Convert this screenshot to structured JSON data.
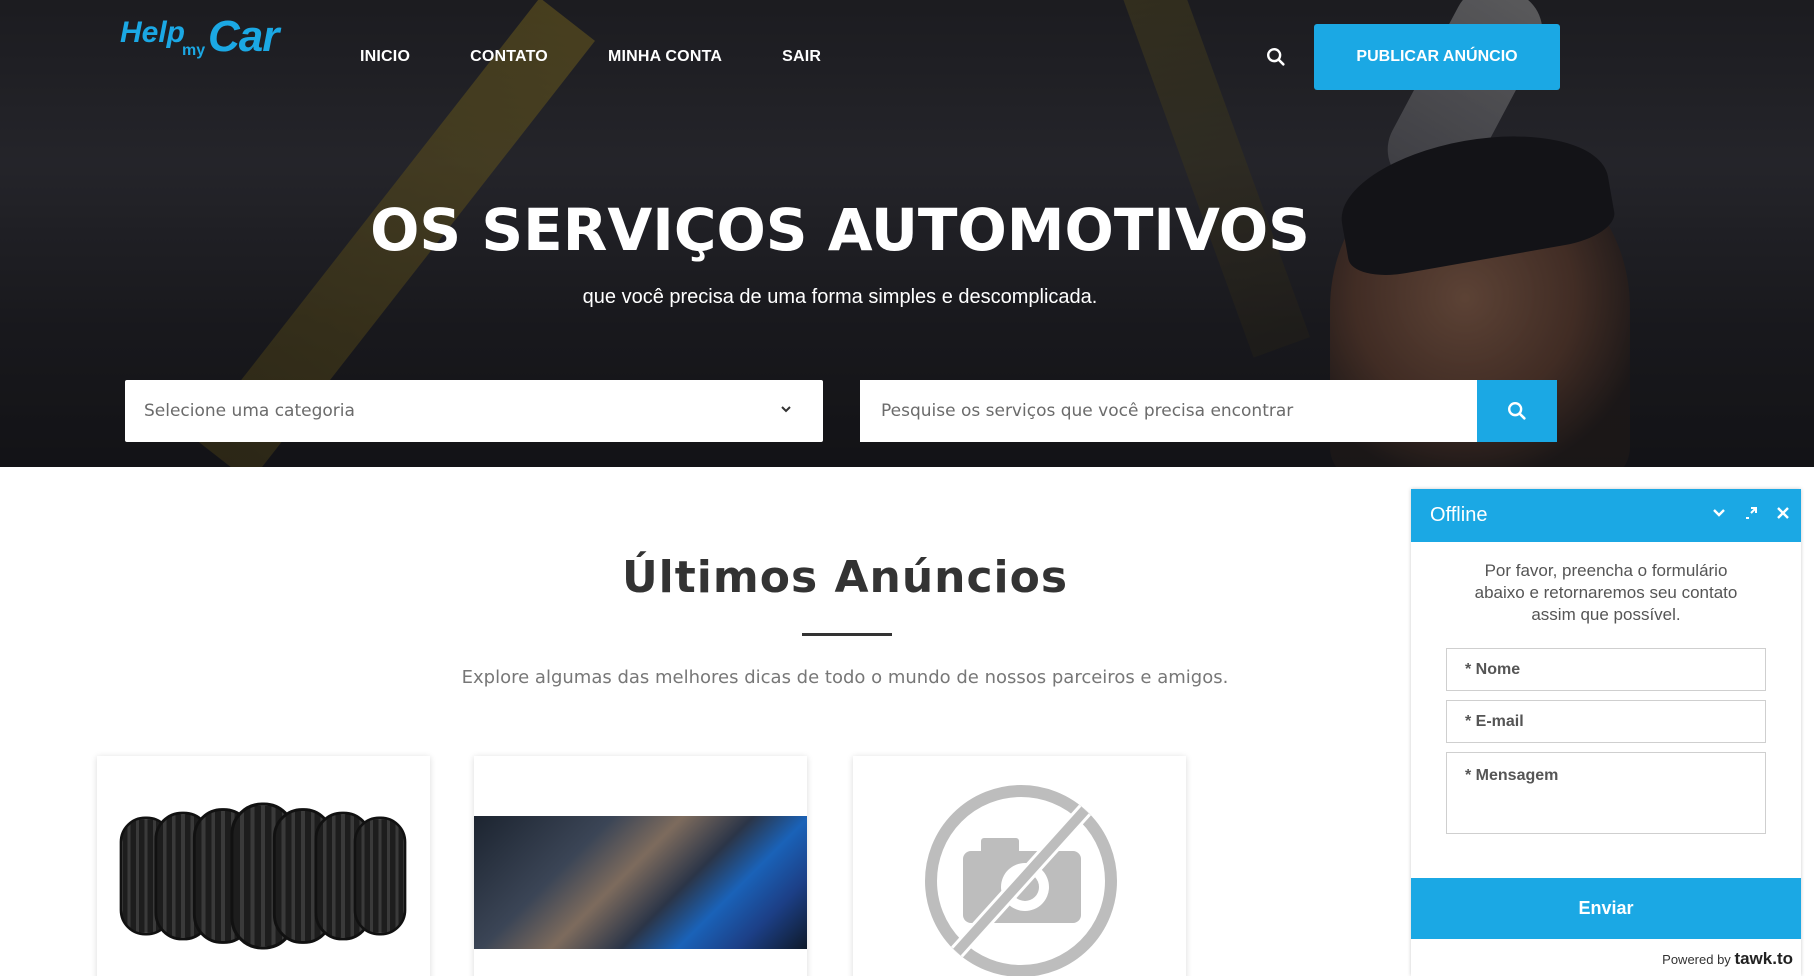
{
  "brand": {
    "logo_help": "Help",
    "logo_my": "my",
    "logo_car": "Car",
    "accent": "#1ba8e4"
  },
  "nav": {
    "items": [
      "INICIO",
      "CONTATO",
      "MINHA CONTA",
      "SAIR"
    ]
  },
  "header": {
    "publish_label": "PUBLICAR ANÚNCIO",
    "search_icon": "search-icon"
  },
  "hero": {
    "title": "OS SERVIÇOS AUTOMOTIVOS",
    "subtitle": "que você precisa de uma forma simples e descomplicada.",
    "category_placeholder": "Selecione uma categoria",
    "search_placeholder": "Pesquise os serviços que você precisa encontrar"
  },
  "listings": {
    "title": "Últimos Anúncios",
    "subtitle": "Explore algumas das melhores dicas de todo o mundo de nossos parceiros e amigos."
  },
  "chat": {
    "status": "Offline",
    "message": "Por favor, preencha o formulário abaixo e retornaremos seu contato assim que possível.",
    "name_placeholder": "* Nome",
    "email_placeholder": "* E-mail",
    "message_placeholder": "* Mensagem",
    "send_label": "Enviar",
    "powered_by": "Powered by",
    "powered_brand": "tawk.to"
  }
}
